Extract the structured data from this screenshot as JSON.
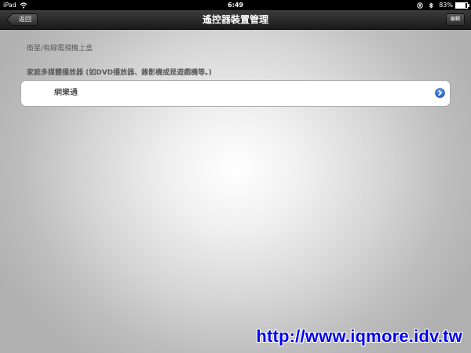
{
  "status_bar": {
    "device": "iPad",
    "time": "6:49",
    "battery": "83%",
    "battery_level": 0.83,
    "icons": [
      "wifi-icon",
      "orientation-lock-icon",
      "bluetooth-icon",
      "battery-icon"
    ]
  },
  "nav": {
    "title": "遙控器裝置管理",
    "back_label": "返回",
    "edit_label": "編輯"
  },
  "sections": [
    {
      "header": "衛星/有線電視機上盒",
      "rows": []
    },
    {
      "header": "家庭多媒體播放器 (如DVD播放器、錄影機或是遊戲機等。)",
      "rows": [
        {
          "label": "網樂通",
          "accessory": "detail-disclosure-icon"
        }
      ]
    }
  ],
  "watermark": "http://www.iqmore.idv.tw",
  "colors": {
    "nav_bar": "#2a2a2a",
    "disclosure": "#2f6fd0",
    "watermark": "#0000ee"
  }
}
